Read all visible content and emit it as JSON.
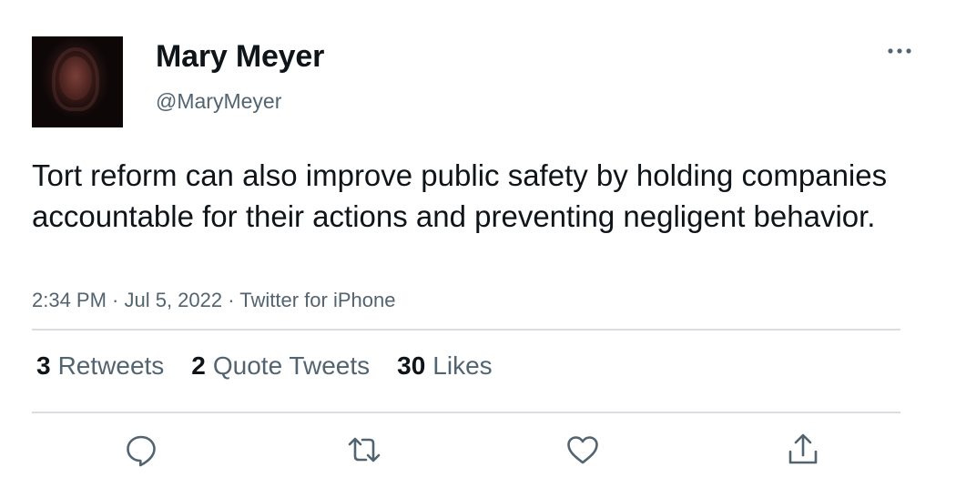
{
  "author": {
    "display_name": "Mary Meyer",
    "handle": "@MaryMeyer"
  },
  "tweet": {
    "text": "Tort reform can also improve public safety by holding companies accountable for their actions and preventing negligent behavior.",
    "meta": "2:34 PM · Jul 5, 2022 · Twitter for iPhone"
  },
  "stats": {
    "retweets": {
      "count": "3",
      "label": "Retweets"
    },
    "quote_tweets": {
      "count": "2",
      "label": "Quote Tweets"
    },
    "likes": {
      "count": "30",
      "label": "Likes"
    }
  },
  "icons": {
    "more": "more-icon",
    "reply": "reply-icon",
    "retweet": "retweet-icon",
    "like": "heart-icon",
    "share": "share-icon"
  },
  "colors": {
    "text": "#0f1419",
    "secondary": "#536471",
    "divider": "#d9dde1"
  }
}
